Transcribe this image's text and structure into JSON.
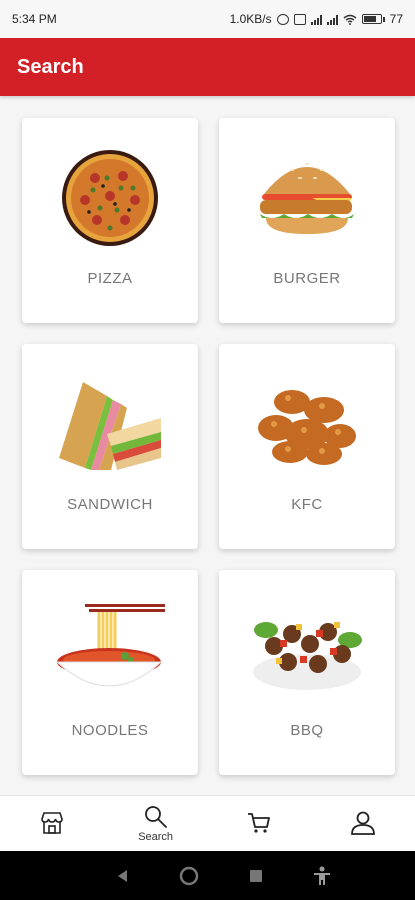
{
  "status_bar": {
    "time": "5:34 PM",
    "network_speed": "1.0KB/s",
    "battery": "77",
    "battery_level": 0.77
  },
  "app_bar": {
    "title": "Search"
  },
  "categories": [
    {
      "label": "PIZZA",
      "icon": "pizza-image"
    },
    {
      "label": "BURGER",
      "icon": "burger-image"
    },
    {
      "label": "SANDWICH",
      "icon": "sandwich-image"
    },
    {
      "label": "KFC",
      "icon": "fried-chicken-image"
    },
    {
      "label": "NOODLES",
      "icon": "noodles-image"
    },
    {
      "label": "BBQ",
      "icon": "bbq-image"
    }
  ],
  "bottom_nav": {
    "items": [
      {
        "icon": "store-icon",
        "label": ""
      },
      {
        "icon": "search-icon",
        "label": "Search"
      },
      {
        "icon": "cart-icon",
        "label": ""
      },
      {
        "icon": "profile-icon",
        "label": ""
      }
    ],
    "active_index": 1
  },
  "colors": {
    "primary": "#d32027",
    "card_label": "#777777"
  }
}
